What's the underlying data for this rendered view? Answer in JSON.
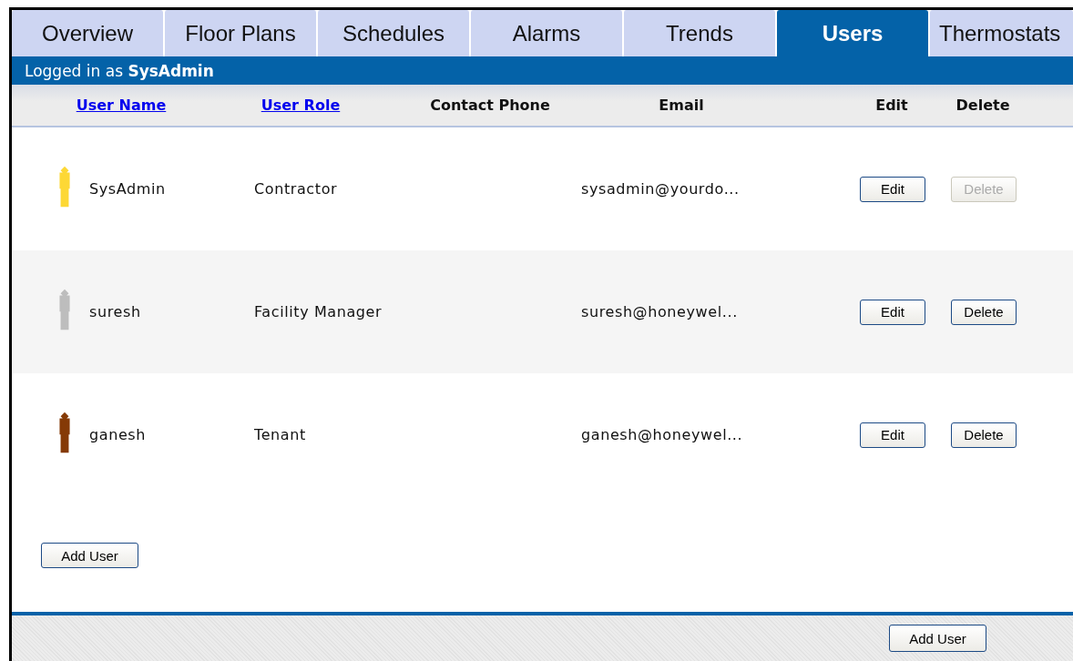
{
  "tabs": [
    {
      "label": "Overview",
      "selected": false
    },
    {
      "label": "Floor Plans",
      "selected": false
    },
    {
      "label": "Schedules",
      "selected": false
    },
    {
      "label": "Alarms",
      "selected": false
    },
    {
      "label": "Trends",
      "selected": false
    },
    {
      "label": "Users",
      "selected": true
    },
    {
      "label": "Thermostats",
      "selected": false
    }
  ],
  "login_bar": {
    "prefix": "Logged in as",
    "user": "SysAdmin"
  },
  "table": {
    "columns": [
      {
        "label": "User Name",
        "kind": "link"
      },
      {
        "label": "User Role",
        "kind": "link"
      },
      {
        "label": "Contact Phone",
        "kind": "plain"
      },
      {
        "label": "Email",
        "kind": "plain"
      },
      {
        "label": "Edit",
        "kind": "plain"
      },
      {
        "label": "Delete",
        "kind": "plain"
      }
    ],
    "rows": [
      {
        "name": "SysAdmin",
        "color": "#fdd835",
        "role": "Contractor",
        "email": "sysadmin@yourdo...",
        "edit": "Edit",
        "delete": "Delete",
        "delete_disabled": true
      },
      {
        "name": "suresh",
        "color": "#bdbdbd",
        "role": "Facility Manager",
        "email": "suresh@honeywel...",
        "edit": "Edit",
        "delete": "Delete",
        "delete_disabled": false
      },
      {
        "name": "ganesh",
        "color": "#853a06",
        "role": "Tenant",
        "email": "ganesh@honeywel...",
        "edit": "Edit",
        "delete": "Delete",
        "delete_disabled": false
      }
    ]
  },
  "add_button": "Add User",
  "footer": {
    "add_button": "Add User"
  }
}
